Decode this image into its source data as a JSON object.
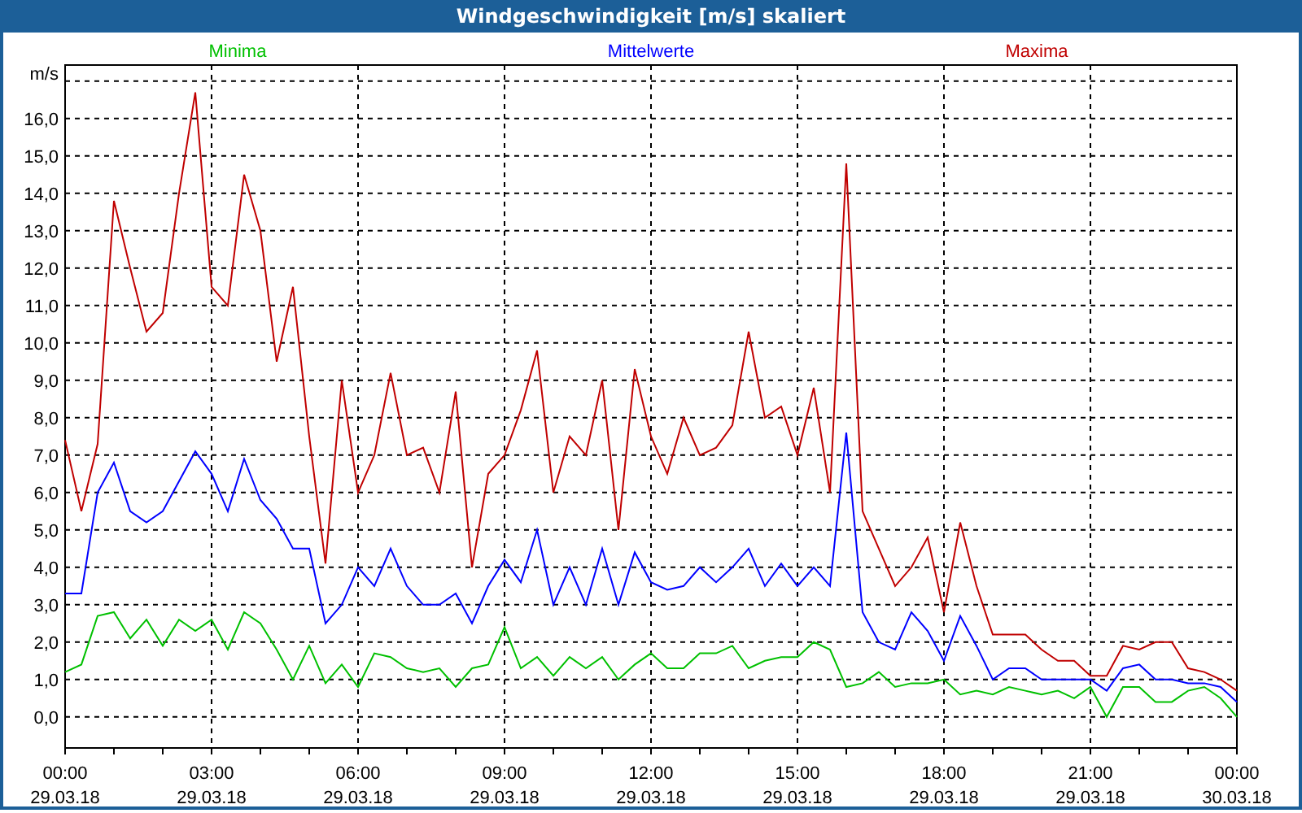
{
  "window": {
    "title": "Windgeschwindigkeit [m/s] skaliert"
  },
  "chart": {
    "chart_data": {
      "type": "line",
      "grid": true,
      "ylabel": "m/s",
      "ylim": [
        -0.83,
        17.43
      ],
      "categories": [
        "00:00 29.03.18",
        null,
        null,
        null,
        null,
        null,
        null,
        null,
        null,
        "03:00 29.03.18",
        null,
        null,
        null,
        null,
        null,
        null,
        null,
        null,
        "06:00 29.03.18",
        null,
        null,
        null,
        null,
        null,
        null,
        null,
        null,
        "09:00 29.03.18",
        null,
        null,
        null,
        null,
        null,
        null,
        null,
        null,
        "12:00 29.03.18",
        null,
        null,
        null,
        null,
        null,
        null,
        null,
        null,
        "15:00 29.03.18",
        null,
        null,
        null,
        null,
        null,
        null,
        null,
        null,
        "18:00 29.03.18",
        null,
        null,
        null,
        null,
        null,
        null,
        null,
        null,
        "21:00 29.03.18",
        null,
        null,
        null,
        null,
        null,
        null,
        null,
        null,
        "00:00 30.03.18"
      ],
      "series": [
        {
          "name": "Minima",
          "color": "#00c000",
          "values": [
            1.2,
            1.4,
            2.7,
            2.8,
            2.1,
            2.6,
            1.9,
            2.6,
            2.3,
            2.6,
            1.8,
            2.8,
            2.5,
            1.8,
            1.0,
            1.9,
            0.9,
            1.4,
            0.8,
            1.7,
            1.6,
            1.3,
            1.2,
            1.3,
            0.8,
            1.3,
            1.4,
            2.4,
            1.3,
            1.6,
            1.1,
            1.6,
            1.3,
            1.6,
            1.0,
            1.4,
            1.7,
            1.3,
            1.3,
            1.7,
            1.7,
            1.9,
            1.3,
            1.5,
            1.6,
            1.6,
            2.0,
            1.8,
            0.8,
            0.9,
            1.2,
            0.8,
            0.9,
            0.9,
            1.0,
            0.6,
            0.7,
            0.6,
            0.8,
            0.7,
            0.6,
            0.7,
            0.5,
            0.8,
            0.0,
            0.8,
            0.8,
            0.4,
            0.4,
            0.7,
            0.8,
            0.5,
            0.0
          ]
        },
        {
          "name": "Mittelwerte",
          "color": "#0000ff",
          "values": [
            3.3,
            3.3,
            6.0,
            6.8,
            5.5,
            5.2,
            5.5,
            6.3,
            7.1,
            6.5,
            5.5,
            6.9,
            5.8,
            5.3,
            4.5,
            4.5,
            2.5,
            3.0,
            4.0,
            3.5,
            4.5,
            3.5,
            3.0,
            3.0,
            3.3,
            2.5,
            3.5,
            4.2,
            3.6,
            5.0,
            3.0,
            4.0,
            3.0,
            4.5,
            3.0,
            4.4,
            3.6,
            3.4,
            3.5,
            4.0,
            3.6,
            4.0,
            4.5,
            3.5,
            4.1,
            3.5,
            4.0,
            3.5,
            7.6,
            2.8,
            2.0,
            1.8,
            2.8,
            2.3,
            1.5,
            2.7,
            1.9,
            1.0,
            1.3,
            1.3,
            1.0,
            1.0,
            1.0,
            1.0,
            0.7,
            1.3,
            1.4,
            1.0,
            1.0,
            0.9,
            0.9,
            0.8,
            0.4
          ]
        },
        {
          "name": "Maxima",
          "color": "#c00000",
          "values": [
            7.4,
            5.5,
            7.3,
            13.8,
            12.0,
            10.3,
            10.8,
            14.0,
            16.7,
            11.5,
            11.0,
            14.5,
            13.0,
            9.5,
            11.5,
            7.5,
            4.1,
            9.0,
            6.0,
            7.0,
            9.2,
            7.0,
            7.2,
            6.0,
            8.7,
            4.0,
            6.5,
            7.0,
            8.2,
            9.8,
            6.0,
            7.5,
            7.0,
            9.0,
            5.0,
            9.3,
            7.5,
            6.5,
            8.0,
            7.0,
            7.2,
            7.8,
            10.3,
            8.0,
            8.3,
            7.0,
            8.8,
            6.0,
            14.8,
            5.5,
            4.5,
            3.5,
            4.0,
            4.8,
            2.8,
            5.2,
            3.5,
            2.2,
            2.2,
            2.2,
            1.8,
            1.5,
            1.5,
            1.1,
            1.1,
            1.9,
            1.8,
            2.0,
            2.0,
            1.3,
            1.2,
            1.0,
            0.7
          ]
        }
      ],
      "yticks": [
        {
          "value": 0,
          "label": "0,0"
        },
        {
          "value": 1,
          "label": "1,0"
        },
        {
          "value": 2,
          "label": "2,0"
        },
        {
          "value": 3,
          "label": "3,0"
        },
        {
          "value": 4,
          "label": "4,0"
        },
        {
          "value": 5,
          "label": "5,0"
        },
        {
          "value": 6,
          "label": "6,0"
        },
        {
          "value": 7,
          "label": "7,0"
        },
        {
          "value": 8,
          "label": "8,0"
        },
        {
          "value": 9,
          "label": "9,0"
        },
        {
          "value": 10,
          "label": "10,0"
        },
        {
          "value": 11,
          "label": "11,0"
        },
        {
          "value": 12,
          "label": "12,0"
        },
        {
          "value": 13,
          "label": "13,0"
        },
        {
          "value": 14,
          "label": "14,0"
        },
        {
          "value": 15,
          "label": "15,0"
        },
        {
          "value": 16,
          "label": "16,0"
        }
      ]
    }
  }
}
